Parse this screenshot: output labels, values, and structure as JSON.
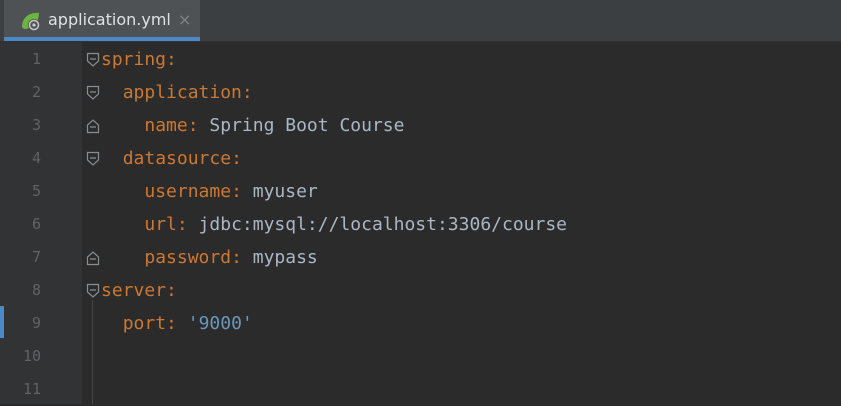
{
  "tab": {
    "title": "application.yml",
    "close": "×",
    "icon": "spring-leaf-icon"
  },
  "lines": [
    {
      "n": "1",
      "indent": "",
      "key": "spring",
      "colon": ":",
      "value": "",
      "vtype": ""
    },
    {
      "n": "2",
      "indent": "  ",
      "key": "application",
      "colon": ":",
      "value": "",
      "vtype": ""
    },
    {
      "n": "3",
      "indent": "    ",
      "key": "name",
      "colon": ":",
      "value": " Spring Boot Course",
      "vtype": "plain"
    },
    {
      "n": "4",
      "indent": "  ",
      "key": "datasource",
      "colon": ":",
      "value": "",
      "vtype": ""
    },
    {
      "n": "5",
      "indent": "    ",
      "key": "username",
      "colon": ":",
      "value": " myuser",
      "vtype": "plain"
    },
    {
      "n": "6",
      "indent": "    ",
      "key": "url",
      "colon": ":",
      "value": " jdbc:mysql://localhost:3306/course",
      "vtype": "plain"
    },
    {
      "n": "7",
      "indent": "    ",
      "key": "password",
      "colon": ":",
      "value": " mypass",
      "vtype": "plain"
    },
    {
      "n": "8",
      "indent": "",
      "key": "server",
      "colon": ":",
      "value": "",
      "vtype": ""
    },
    {
      "n": "9",
      "indent": "  ",
      "key": "port",
      "colon": ":",
      "value": " '9000'",
      "vtype": "num"
    },
    {
      "n": "10",
      "indent": "",
      "key": "",
      "colon": "",
      "value": "",
      "vtype": ""
    },
    {
      "n": "11",
      "indent": "",
      "key": "",
      "colon": "",
      "value": "",
      "vtype": ""
    }
  ],
  "colors": {
    "key": "#cc7832",
    "text": "#a9b7c6",
    "number": "#6897bb",
    "background": "#2b2b2b",
    "tab_accent": "#4a88c7"
  }
}
